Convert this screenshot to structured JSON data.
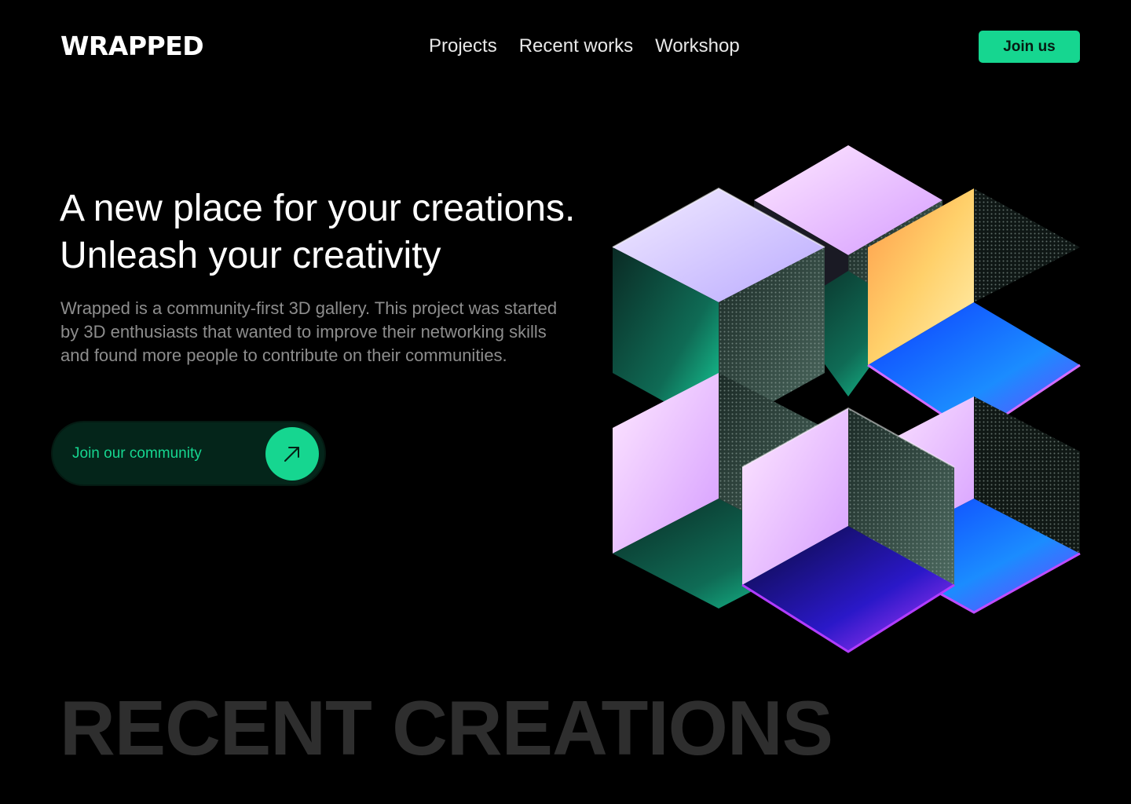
{
  "header": {
    "logo": "WRAPPED",
    "nav": [
      "Projects",
      "Recent works",
      "Workshop"
    ],
    "cta_label": "Join us"
  },
  "hero": {
    "title_line1": "A new place for your creations.",
    "title_line2": "Unleash your creativity",
    "description": "Wrapped is a community-first 3D gallery. This project was started by 3D enthusiasts that wanted to improve their networking skills and found more people to contribute on their communities.",
    "cta_label": "Join our community",
    "cta_icon": "arrow-up-right-icon"
  },
  "artwork": {
    "description_icon": "iridescent-cube-cluster",
    "colors": [
      "#e9d8ff",
      "#ffc46a",
      "#1f7cff",
      "#12c98f",
      "#d8a6ff",
      "#6b2cff"
    ]
  },
  "section": {
    "title": "RECENT CREATIONS"
  },
  "colors": {
    "background": "#000000",
    "accent": "#16d690",
    "muted_text": "#8d8d8d",
    "section_title": "#2e2e2e"
  }
}
